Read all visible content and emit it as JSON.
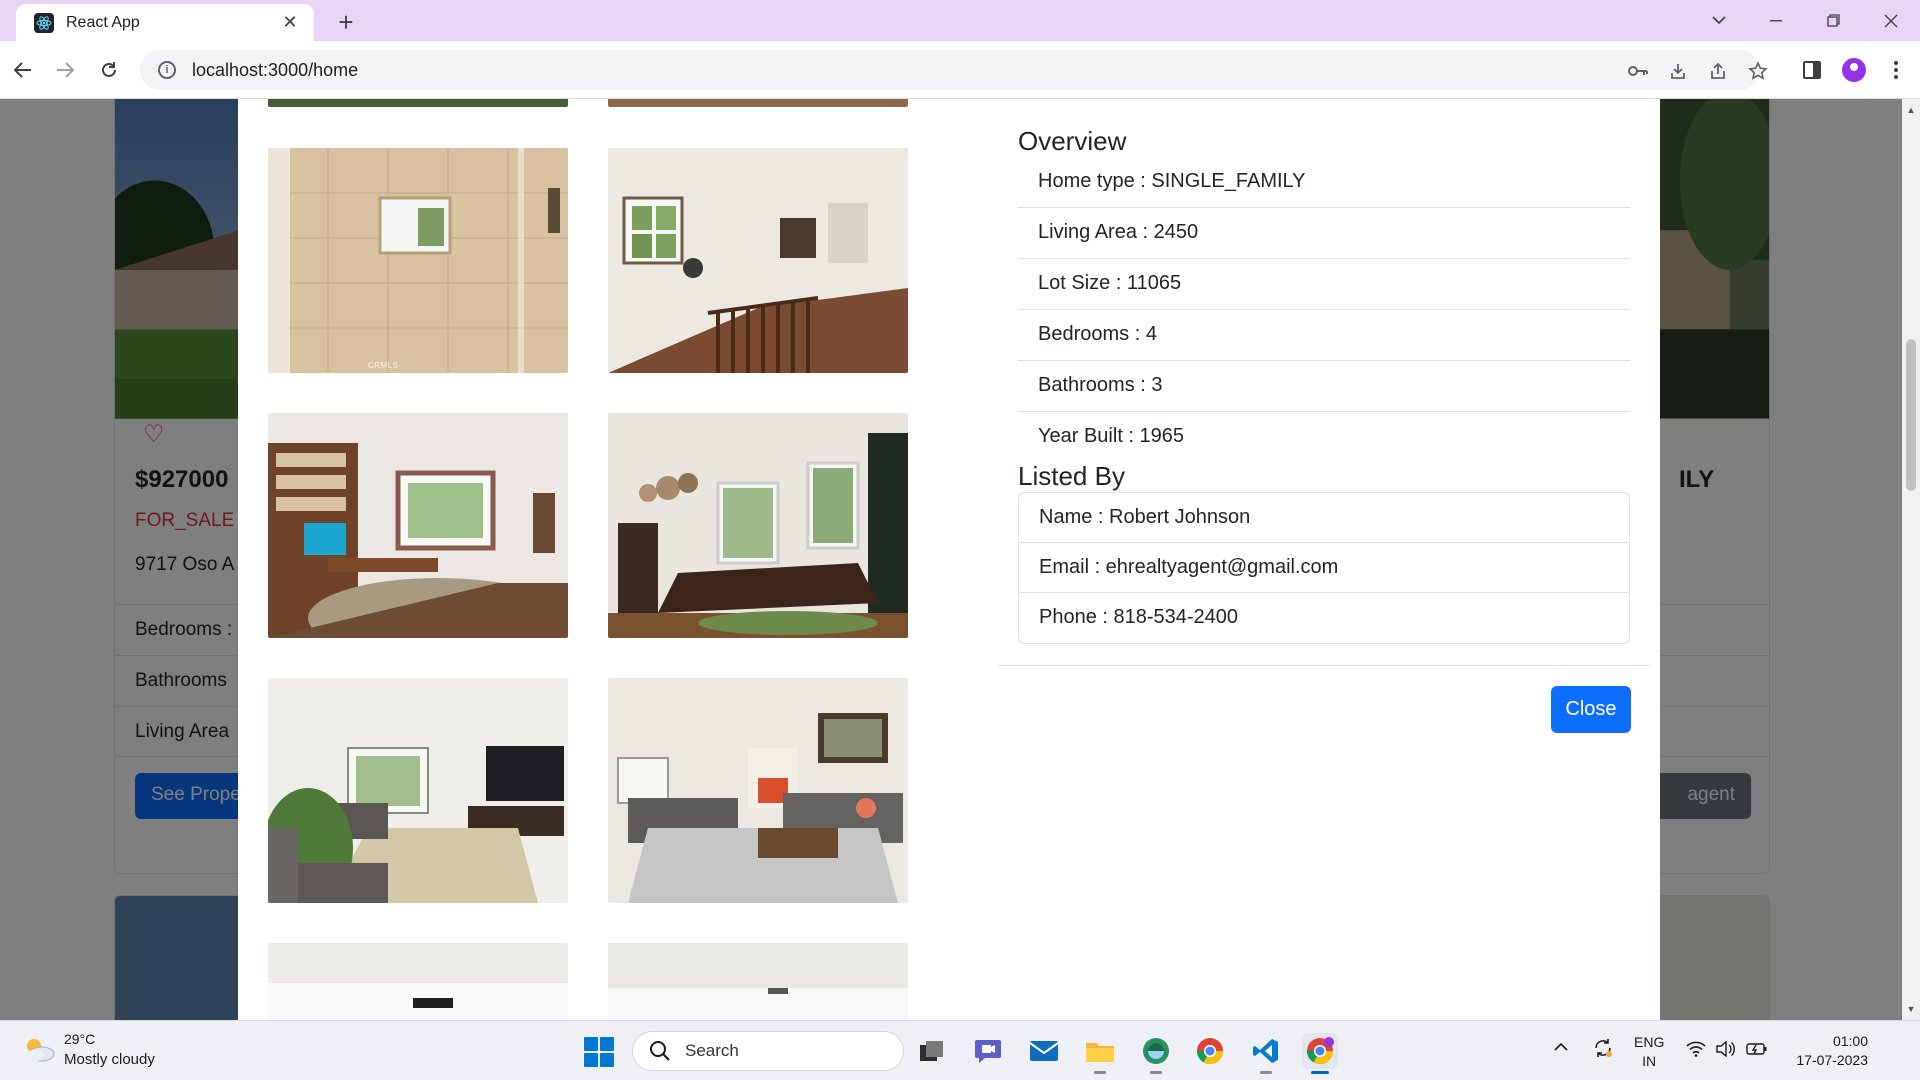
{
  "browser": {
    "tab_title": "React App",
    "url": "localhost:3000/home"
  },
  "page": {
    "left_card": {
      "price": "$927000",
      "status": "FOR_SALE",
      "address": "9717 Oso A",
      "bedrooms_label": "Bedrooms :",
      "bathrooms_label": "Bathrooms",
      "living_area_label": "Living Area",
      "button_label": "See Prope"
    },
    "right_card": {
      "type_fragment": "ILY",
      "button_label": "agent"
    }
  },
  "modal": {
    "overview_title": "Overview",
    "overview": [
      "Home type : SINGLE_FAMILY",
      "Living Area : 2450",
      "Lot Size : 11065",
      "Bedrooms : 4",
      "Bathrooms : 3",
      "Year Built : 1965"
    ],
    "listed_by_title": "Listed By",
    "listed_by": [
      "Name : Robert Johnson",
      "Email : ehrealtyagent@gmail.com",
      "Phone : 818-534-2400"
    ],
    "close_label": "Close",
    "photo_watermark": "CRMLS"
  },
  "taskbar": {
    "temperature": "29°C",
    "weather": "Mostly cloudy",
    "search_placeholder": "Search",
    "lang_1": "ENG",
    "lang_2": "IN",
    "time": "01:00",
    "date": "17-07-2023"
  },
  "colors": {
    "primary": "#0d6efd",
    "danger": "#dc3545",
    "tab_strip": "#e8d5f6"
  }
}
